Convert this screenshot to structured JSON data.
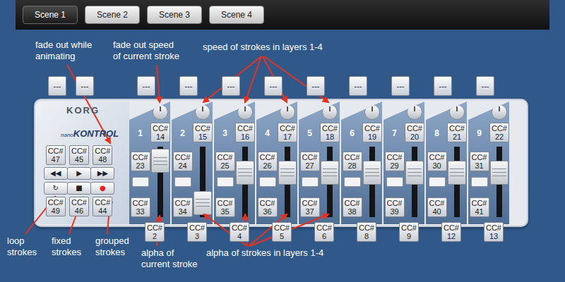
{
  "tabs": [
    {
      "label": "Scene 1",
      "selected": true
    },
    {
      "label": "Scene 2",
      "selected": false
    },
    {
      "label": "Scene 3",
      "selected": false
    },
    {
      "label": "Scene 4",
      "selected": false
    }
  ],
  "annotations": [
    {
      "lines": [
        "fade out while",
        "animating"
      ]
    },
    {
      "lines": [
        "fade out speed",
        "of current stroke"
      ]
    },
    {
      "lines": [
        "speed of strokes in layers 1-4"
      ]
    },
    {
      "lines": [
        "loop",
        "strokes"
      ]
    },
    {
      "lines": [
        "fixed",
        "strokes"
      ]
    },
    {
      "lines": [
        "grouped",
        "strokes"
      ]
    },
    {
      "lines": [
        "alpha of",
        "current stroke"
      ]
    },
    {
      "lines": [
        "alpha of strokes in layers 1-4"
      ]
    }
  ],
  "device": {
    "brand": "KORG",
    "model_prefix": "nano",
    "model": "KONTROL",
    "transport_assign": [
      "---",
      "---"
    ],
    "transport_top_cc": [
      {
        "label": "CC#",
        "number": "47"
      },
      {
        "label": "CC#",
        "number": "45"
      },
      {
        "label": "CC#",
        "number": "48"
      }
    ],
    "transport_buttons": [
      {
        "glyph": "◀◀",
        "color": "#222222"
      },
      {
        "glyph": "▶",
        "color": "#222222"
      },
      {
        "glyph": "▶▶",
        "color": "#222222"
      },
      {
        "glyph": "↻",
        "color": "#222222"
      },
      {
        "glyph": "■",
        "color": "#222222"
      },
      {
        "glyph": "●",
        "color": "#e02424"
      }
    ],
    "transport_bottom_cc": [
      {
        "label": "CC#",
        "number": "49"
      },
      {
        "label": "CC#",
        "number": "46"
      },
      {
        "label": "CC#",
        "number": "44"
      }
    ],
    "channels": [
      {
        "number": "1",
        "assign": "---",
        "knob": {
          "label": "CC#",
          "number": "14"
        },
        "button_top": {
          "label": "CC#",
          "number": "23"
        },
        "button_bottom": {
          "label": "CC#",
          "number": "33"
        },
        "fader": {
          "label": "CC#",
          "number": "2",
          "level": 0.95
        }
      },
      {
        "number": "2",
        "assign": "---",
        "knob": {
          "label": "CC#",
          "number": "15"
        },
        "button_top": {
          "label": "CC#",
          "number": "24"
        },
        "button_bottom": {
          "label": "CC#",
          "number": "34"
        },
        "fader": {
          "label": "CC#",
          "number": "3",
          "level": 0.05
        }
      },
      {
        "number": "3",
        "assign": "---",
        "knob": {
          "label": "CC#",
          "number": "16"
        },
        "button_top": {
          "label": "CC#",
          "number": "25"
        },
        "button_bottom": {
          "label": "CC#",
          "number": "35"
        },
        "fader": {
          "label": "CC#",
          "number": "4",
          "level": 0.7
        }
      },
      {
        "number": "4",
        "assign": "---",
        "knob": {
          "label": "CC#",
          "number": "17"
        },
        "button_top": {
          "label": "CC#",
          "number": "26"
        },
        "button_bottom": {
          "label": "CC#",
          "number": "36"
        },
        "fader": {
          "label": "CC#",
          "number": "5",
          "level": 0.7
        }
      },
      {
        "number": "5",
        "assign": "---",
        "knob": {
          "label": "CC#",
          "number": "18"
        },
        "button_top": {
          "label": "CC#",
          "number": "27"
        },
        "button_bottom": {
          "label": "CC#",
          "number": "37"
        },
        "fader": {
          "label": "CC#",
          "number": "6",
          "level": 0.7
        }
      },
      {
        "number": "6",
        "assign": "---",
        "knob": {
          "label": "CC#",
          "number": "19"
        },
        "button_top": {
          "label": "CC#",
          "number": "28"
        },
        "button_bottom": {
          "label": "CC#",
          "number": "38"
        },
        "fader": {
          "label": "CC#",
          "number": "8",
          "level": 0.7
        }
      },
      {
        "number": "7",
        "assign": "---",
        "knob": {
          "label": "CC#",
          "number": "20"
        },
        "button_top": {
          "label": "CC#",
          "number": "29"
        },
        "button_bottom": {
          "label": "CC#",
          "number": "39"
        },
        "fader": {
          "label": "CC#",
          "number": "9",
          "level": 0.7
        }
      },
      {
        "number": "8",
        "assign": "---",
        "knob": {
          "label": "CC#",
          "number": "21"
        },
        "button_top": {
          "label": "CC#",
          "number": "30"
        },
        "button_bottom": {
          "label": "CC#",
          "number": "40"
        },
        "fader": {
          "label": "CC#",
          "number": "12",
          "level": 0.7
        }
      },
      {
        "number": "9",
        "assign": "---",
        "knob": {
          "label": "CC#",
          "number": "22"
        },
        "button_top": {
          "label": "CC#",
          "number": "31"
        },
        "button_bottom": {
          "label": "CC#",
          "number": "41"
        },
        "fader": {
          "label": "CC#",
          "number": "13",
          "level": 0.7
        }
      }
    ]
  }
}
